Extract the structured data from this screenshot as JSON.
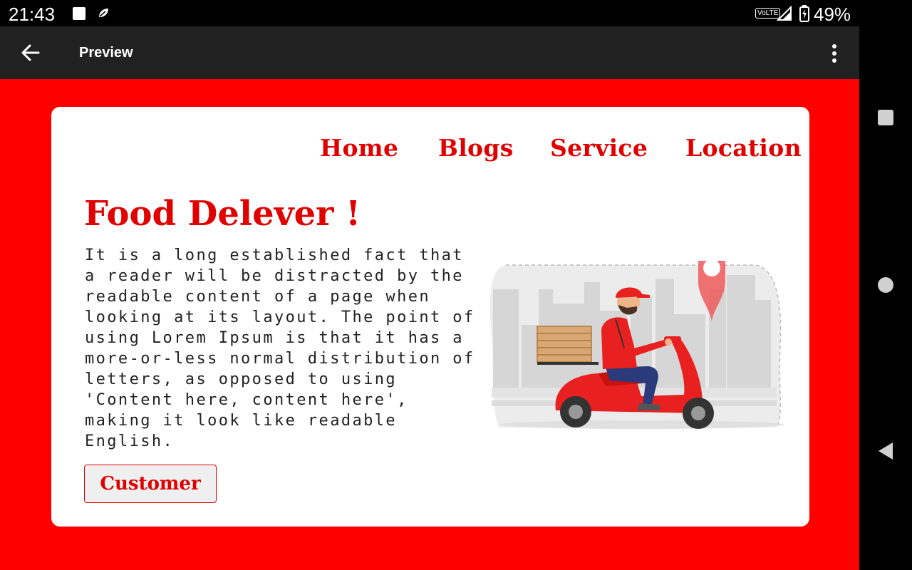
{
  "status_bar": {
    "time": "21:43",
    "network": "VoLTE",
    "battery": "49%",
    "icons": [
      "square-notification-icon",
      "leaf-icon",
      "volte-icon",
      "signal-icon",
      "battery-charging-icon"
    ]
  },
  "app_bar": {
    "title": "Preview",
    "back_icon": "arrow-left-icon",
    "menu_icon": "more-vert-icon"
  },
  "page": {
    "nav": [
      "Home",
      "Blogs",
      "Service",
      "Location"
    ],
    "title": "Food Delever !",
    "body": "It is a long established fact that a reader will be distracted by the readable content of a page when looking at its layout. The point of using Lorem Ipsum is that it has a more-or-less normal distribution of letters, as opposed to using 'Content here, content here', making it look like readable English.",
    "button": "Customer",
    "illustration": "delivery-scooter-illustration"
  },
  "colors": {
    "accent": "#ff0000",
    "text_red": "#e00000",
    "app_bar": "#212121"
  }
}
